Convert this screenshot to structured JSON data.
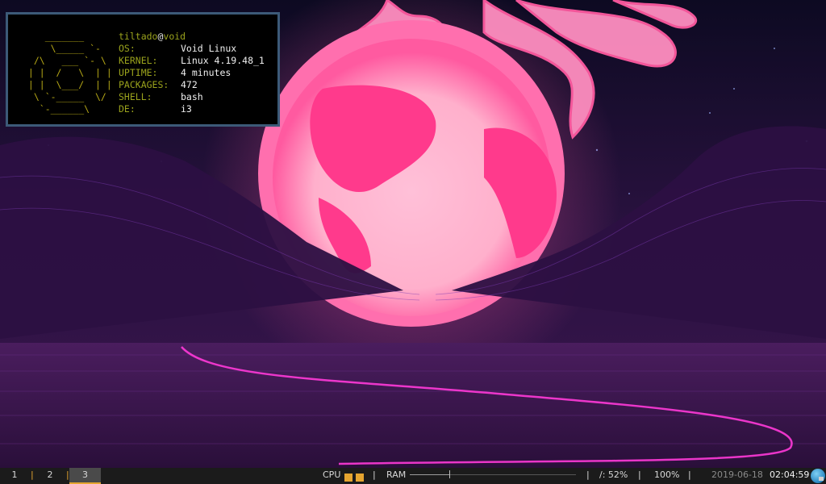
{
  "terminal": {
    "ascii_art": [
      "    _______",
      "     \\_____ `-",
      "  /\\   ___ `- \\",
      " | |  /   \\  | |",
      " | |  \\___/  | |",
      "  \\ `-_____  \\/",
      "   `-______\\"
    ],
    "user": "tiltado",
    "at": "@",
    "host": "void",
    "fields": [
      {
        "key": "OS:",
        "value": "Void Linux"
      },
      {
        "key": "KERNEL:",
        "value": "Linux 4.19.48_1"
      },
      {
        "key": "UPTIME:",
        "value": "4 minutes"
      },
      {
        "key": "PACKAGES:",
        "value": "472"
      },
      {
        "key": "SHELL:",
        "value": "bash"
      },
      {
        "key": "DE:",
        "value": "i3"
      }
    ]
  },
  "bar": {
    "workspaces": [
      "1",
      "2",
      "3"
    ],
    "active_workspace": "3",
    "separators": [
      "|",
      "|",
      "|",
      "|",
      "|",
      "|"
    ],
    "cpu_label": "CPU",
    "ram_label": "RAM",
    "ram_usage_fraction": 0.24,
    "disk": "/: 52%",
    "battery": "100%",
    "date": "2019-06-18",
    "time": "02:04:59"
  },
  "colors": {
    "accent": "#e5a530",
    "terminal_border": "#3c5a78",
    "terminal_key": "#9aa21c",
    "ascii_logo": "#b5a716"
  }
}
